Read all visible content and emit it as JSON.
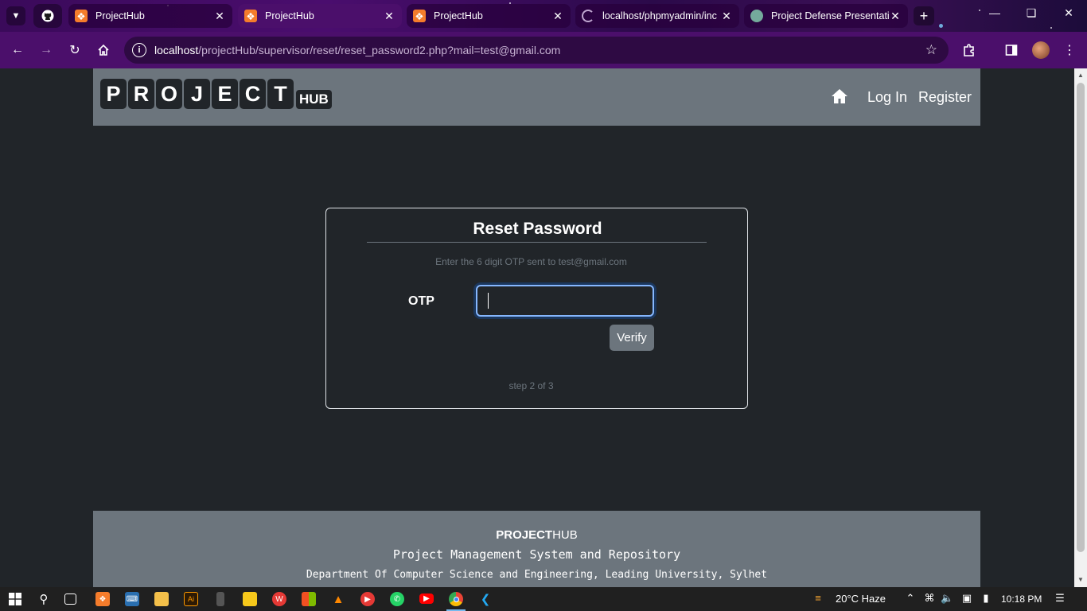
{
  "browser": {
    "tabs": [
      {
        "title": "ProjectHub",
        "state": "inactive"
      },
      {
        "title": "ProjectHub",
        "state": "active"
      },
      {
        "title": "ProjectHub",
        "state": "inactive"
      },
      {
        "title": "localhost/phpmyadmin/inc",
        "state": "inactive"
      },
      {
        "title": "Project Defense Presentatio",
        "state": "inactive"
      }
    ],
    "url_host": "localhost",
    "url_path": "/projectHub/supervisor/reset/reset_password2.php?mail=test@gmail.com"
  },
  "navbar": {
    "logo_letters": [
      "P",
      "R",
      "O",
      "J",
      "E",
      "C",
      "T"
    ],
    "logo_suffix": "HUB",
    "login_label": "Log In",
    "register_label": "Register"
  },
  "card": {
    "title": "Reset Password",
    "hint": "Enter the 6 digit OTP sent to test@gmail.com",
    "otp_label": "OTP",
    "otp_value": "",
    "verify_label": "Verify",
    "step_text": "step 2 of 3"
  },
  "footer": {
    "brand_bold": "PROJECT",
    "brand_light": "HUB",
    "subtitle": "Project Management System and Repository",
    "department": "Department Of Computer Science and Engineering, Leading University, Sylhet"
  },
  "taskbar": {
    "weather": "20°C  Haze",
    "time": "10:18 PM"
  },
  "colors": {
    "page_bg": "#212529",
    "navbar_bg": "#6c757d",
    "chrome_toolbar": "#4b0f6b",
    "input_focus": "#86b7fe"
  }
}
